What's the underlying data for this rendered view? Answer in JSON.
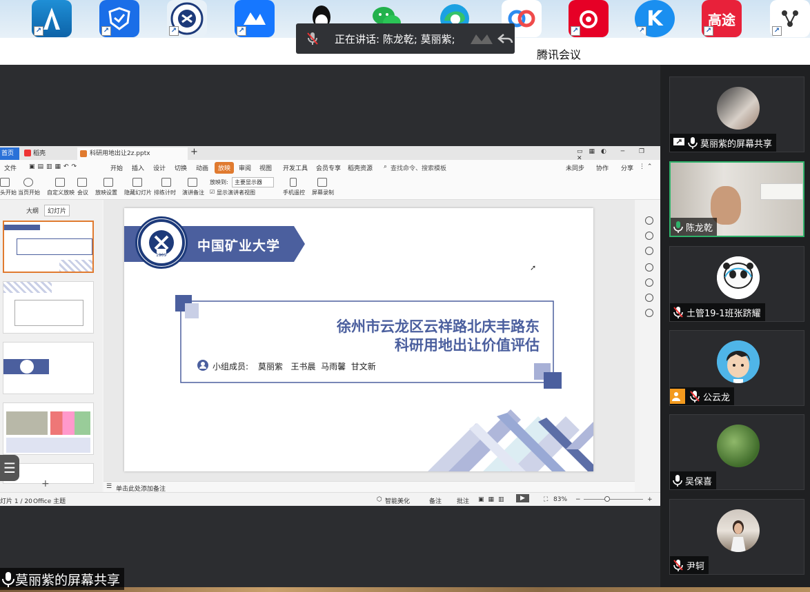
{
  "colors": {
    "accent_green": "#2fb36b",
    "wps_orange": "#e07a2f",
    "slide_blue": "#4b5f9e"
  },
  "taskbar": {
    "icons": [
      {
        "name": "autodesk-icon"
      },
      {
        "name": "qq-pc-manager-icon"
      },
      {
        "name": "cumt-emblem-icon"
      },
      {
        "name": "tencent-meeting-icon"
      },
      {
        "name": "qq-icon"
      },
      {
        "name": "wechat-icon"
      },
      {
        "name": "edge-icon"
      },
      {
        "name": "baidu-netdisk-icon"
      },
      {
        "name": "netease-music-icon"
      },
      {
        "name": "kugou-icon"
      },
      {
        "name": "futu-icon",
        "label": "高途"
      },
      {
        "name": "network-app-icon"
      }
    ]
  },
  "meeting": {
    "speaking_text": "正在讲话: 陈龙乾; 莫丽紫;",
    "app_title": "腾讯会议"
  },
  "wps": {
    "tabs": [
      {
        "label": "首页"
      },
      {
        "label": "稻壳"
      },
      {
        "label": "科研用地出让2z.pptx"
      }
    ],
    "menu": [
      "文件",
      "开始",
      "插入",
      "设计",
      "切换",
      "动画",
      "放映",
      "审阅",
      "视图",
      "开发工具",
      "会员专享",
      "稻壳资源"
    ],
    "menu_active": "放映",
    "search": "查找命令、搜索模板",
    "right_actions": [
      "未同步",
      "协作",
      "分享"
    ],
    "toolbar": [
      "头开始",
      "当页开始",
      "自定义放映",
      "会议",
      "放映设置",
      "隐藏幻灯片",
      "排练计时",
      "演讲备注",
      "显示演讲者视图",
      "手机遥控",
      "屏幕录制"
    ],
    "monitor_label": "放映到:",
    "monitor_value": "主要显示器",
    "panel_tabs": [
      "大纲",
      "幻灯片"
    ],
    "notes_placeholder": "单击此处添加备注",
    "status": {
      "page": "灯片 1 / 20",
      "theme": "Office 主题",
      "beautify": "智能美化",
      "notes": "备注",
      "comments": "批注",
      "zoom": "83%"
    }
  },
  "slide": {
    "university": "中国矿业大学",
    "title_line1": "徐州市云龙区云祥路北庆丰路东",
    "title_line2": "科研用地出让价值评估",
    "members_label": "小组成员:",
    "members": "莫丽紫   王书晨  马雨馨  甘文新",
    "seal_year": "1909"
  },
  "participants": [
    {
      "name": "莫丽紫的屏幕共享",
      "muted": false,
      "sharing": true
    },
    {
      "name": "陈龙乾",
      "muted": false,
      "active": true
    },
    {
      "name": "土管19-1班张跻耀",
      "muted": true
    },
    {
      "name": "公云龙",
      "muted": true,
      "host": true
    },
    {
      "name": "吴保喜",
      "muted": false
    },
    {
      "name": "尹轲",
      "muted": true
    }
  ],
  "share_label": "莫丽紫的屏幕共享"
}
